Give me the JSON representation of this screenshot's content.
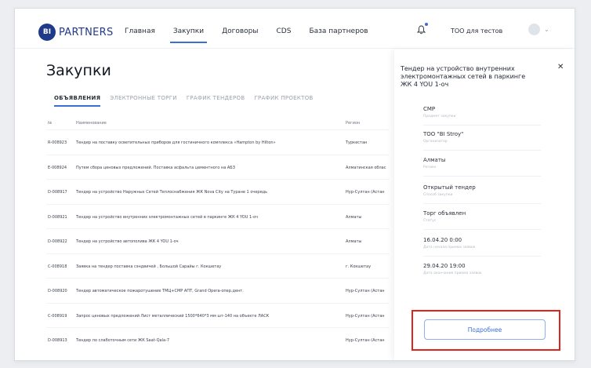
{
  "brand": {
    "mark": "BI",
    "name": "PARTNERS"
  },
  "nav": {
    "items": [
      "Главная",
      "Закупки",
      "Договоры",
      "CDS",
      "База партнеров"
    ],
    "active_index": 1
  },
  "header": {
    "org": "ТОО для тестов"
  },
  "page": {
    "title": "Закупки"
  },
  "tabs": {
    "items": [
      "ОБЪЯВЛЕНИЯ",
      "ЭЛЕКТРОННЫЕ ТОРГИ",
      "ГРАФИК ТЕНДЕРОВ",
      "ГРАФИК ПРОЕКТОВ"
    ],
    "active_index": 0
  },
  "table": {
    "headers": [
      "№",
      "Наименование",
      "Регион"
    ],
    "rows": [
      [
        "R-008923",
        "Тендер на поставку осветительных приборов для гостиничного комплекса «Hampton by Hilton»",
        "Туркестан"
      ],
      [
        "E-008924",
        "Путем сбора ценовых предложений. Поставка асфальта цементного на АБЗ",
        "Алматинская облас"
      ],
      [
        "D-008917",
        "Тендер на устройство Наружных Сетей Теплоснабжения ЖК Nova City на Туране 1 очередь",
        "Нур-Султан (Астан"
      ],
      [
        "D-008921",
        "Тендер на устройство внутренних электромонтажных сетей в паркинге ЖК 4 YOU 1-оч",
        "Алматы"
      ],
      [
        "D-008922",
        "Тендер на устройство автополива ЖК 4 YOU 1-оч",
        "Алматы"
      ],
      [
        "C-008918",
        "Заявка на тендер поставка сэндвичей , Большой Сарайы г. Кокшетау",
        "г. Кокшетау"
      ],
      [
        "D-008920",
        "Тендер автоматическое пожаротушение ТМЦ+СМР АПТ, Grand Opera-опер.дент.",
        "Нур-Султан (Астан"
      ],
      [
        "C-008919",
        "Запрос ценовых предложений Лист металлический 1500*640*3 мм шт-140 на объекте ЛАСК",
        "Нур-Султан (Астан"
      ],
      [
        "D-008913",
        "Тендер по слаботочным сети ЖК Saat-Qala-7",
        "Нур-Султан (Астан"
      ]
    ]
  },
  "panel": {
    "title": "Тендер на устройство внутренних электромонтажных сетей в паркинге ЖК 4 YOU 1-оч",
    "fields": [
      {
        "value": "СМР",
        "label": "Предмет закупки"
      },
      {
        "value": "ТОО \"BI Stroy\"",
        "label": "Организатор"
      },
      {
        "value": "Алматы",
        "label": "Регион"
      },
      {
        "value": "Открытый тендер",
        "label": "Способ закупки"
      },
      {
        "value": "Торг объявлен",
        "label": "Статус"
      },
      {
        "value": "16.04.20 0:00",
        "label": "Дата начала приема заявок"
      },
      {
        "value": "29.04.20 19:00",
        "label": "Дата окончания приема заявок"
      }
    ],
    "more_label": "Подробнее"
  }
}
